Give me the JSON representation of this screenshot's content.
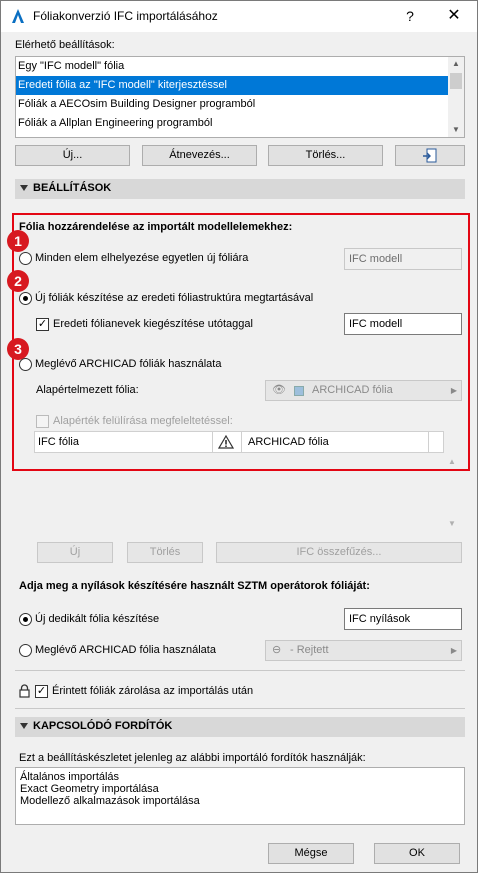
{
  "window": {
    "title": "Fóliakonverzió IFC importálásához",
    "help_glyph": "?",
    "close_glyph": "✕"
  },
  "available_settings": {
    "label": "Elérhető beállítások:",
    "items": [
      "Egy \"IFC modell\" fólia",
      "Eredeti fólia az \"IFC modell\" kiterjesztéssel",
      "Fóliák a AECOsim Building Designer programból",
      "Fóliák a Allplan Engineering programból"
    ],
    "selected_index": 1
  },
  "list_buttons": {
    "new": "Új...",
    "rename": "Átnevezés...",
    "delete": "Törlés..."
  },
  "settings_section": {
    "title": "BEÁLLÍTÁSOK"
  },
  "assignment": {
    "heading": "Fólia hozzárendelése az importált modellelemekhez:",
    "badges": [
      "1",
      "2",
      "3"
    ],
    "option1": {
      "label": "Minden elem elhelyezése egyetlen új fóliára",
      "value": "IFC modell"
    },
    "option2": {
      "label": "Új fóliák készítése az eredeti fóliastruktúra megtartásával",
      "suffix_check_label": "Eredeti fólianevek kiegészítése utótaggal",
      "suffix_value": "IFC modell"
    },
    "option3": {
      "label": "Meglévő ARCHICAD fóliák használata",
      "default_layer_label": "Alapértelmezett fólia:",
      "default_layer_value": "ARCHICAD fólia",
      "override_label": "Alapérték felülírása megfeleltetéssel:",
      "table_row": {
        "ifc": "IFC fólia",
        "archicad": "ARCHICAD fólia"
      }
    }
  },
  "mapping_buttons": {
    "new": "Új",
    "delete": "Törlés",
    "merge": "IFC összefűzés..."
  },
  "openings": {
    "heading": "Adja meg a nyílások készítésére használt SZTM operátorok fóliáját:",
    "option_new": "Új dedikált fólia készítése",
    "option_new_value": "IFC nyílások",
    "option_existing": "Meglévő ARCHICAD fólia használata",
    "option_existing_value": "- Rejtett"
  },
  "lock": {
    "label": "Érintett fóliák zárolása az importálás után",
    "checked": true
  },
  "translators_section": {
    "title": "KAPCSOLÓDÓ FORDÍTÓK",
    "info": "Ezt a beállításkészletet jelenleg az alábbi importáló fordítók használják:",
    "items": [
      "Általános importálás",
      "Exact Geometry importálása",
      "Modellező alkalmazások importálása"
    ]
  },
  "footer": {
    "cancel": "Mégse",
    "ok": "OK"
  },
  "colors": {
    "selection": "#0078d7",
    "highlight_frame": "#e30613",
    "badge": "#d71920"
  }
}
